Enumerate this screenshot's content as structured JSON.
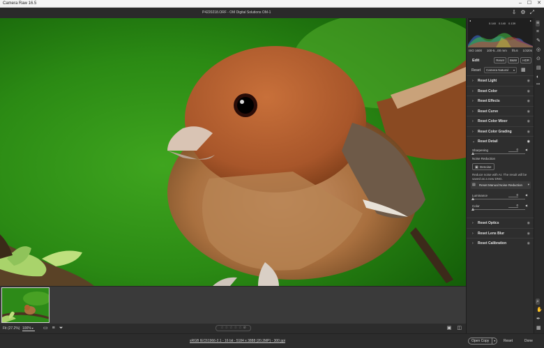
{
  "app": {
    "title": "Camera Raw 16.5"
  },
  "window_controls": [
    "–",
    "☐",
    "✕"
  ],
  "document": {
    "name": "P4220218.ORF  -  OM Digital Solutions OM-1"
  },
  "doc_tools": {
    "save_icon": "⇩",
    "settings_icon": "⚙",
    "fullscreen_icon": "⤢"
  },
  "histogram": {
    "clip_shadow": "◂",
    "clip_highlight": "▸",
    "info_left": "0.140",
    "info_mid": "0.140",
    "info_right": "0.139",
    "colors": {
      "blue": "#3b6fd8",
      "green": "#3fbf3f",
      "red": "#d13b3b",
      "yellow": "#c8c83a"
    }
  },
  "exif": {
    "iso": "ISO 1600",
    "lens": "100-5...00 mm",
    "aperture": "f/5.6",
    "shutter": "1/320s"
  },
  "edit": {
    "title": "Edit",
    "reset_label": "Reset",
    "bw_label": "B&W",
    "hdr_label": "HDR",
    "profile_label": "Reset",
    "profile_value": "Camera Natural",
    "profile_grid_icon": "▦"
  },
  "sections": [
    {
      "label": "Reset Light"
    },
    {
      "label": "Reset Color"
    },
    {
      "label": "Reset Effects"
    },
    {
      "label": "Reset Curve"
    },
    {
      "label": "Reset Color Mixer"
    },
    {
      "label": "Reset Color Grading"
    }
  ],
  "detail": {
    "label": "Reset Detail",
    "sharpening_label": "Sharpening",
    "sharpening_value": "0",
    "noise_reduction_label": "Noise Reduction",
    "denoise_label": "Denoise",
    "note": "Reduce noise with AI. The result will be saved as a new DNG.",
    "manual_label": "Reset Manual Noise Reduction",
    "luminance_label": "Luminance",
    "luminance_value": "0",
    "color_label": "Color",
    "color_value": "0"
  },
  "sections_after": [
    {
      "label": "Reset Optics"
    },
    {
      "label": "Reset Lens Blur"
    },
    {
      "label": "Reset Calibration"
    }
  ],
  "rail_tools": {
    "edit_icon": "≡",
    "crop_icon": "⌗",
    "heal_icon": "✎",
    "mask_icon": "◎",
    "redeye_icon": "⊙",
    "presets_icon": "▤",
    "snapshots_icon": "◐",
    "more_icon": "•••",
    "zoom_icon": "⌕",
    "hand_icon": "✋",
    "sampler_icon": "✒",
    "grid_icon": "▦"
  },
  "view": {
    "fit_label": "Fit (27.2%)",
    "zoom_value": "100%",
    "filmstrip_icon": "▭",
    "sort_icon": "≡",
    "filter_icon": "⏷",
    "stars": [
      "☆",
      "☆",
      "☆",
      "☆",
      "☆"
    ],
    "stars_clear": "⊘",
    "single_view_icon": "▣",
    "compare_icon": "◫"
  },
  "bottom": {
    "info": "sRGB IEC61966-2.1 - 16 bit - 5184 x 3888 (20.2MP) - 300 ppi",
    "open_copy_label": "Open Copy",
    "open_dropdown": "▾",
    "reset_label": "Reset",
    "done_label": "Done"
  }
}
